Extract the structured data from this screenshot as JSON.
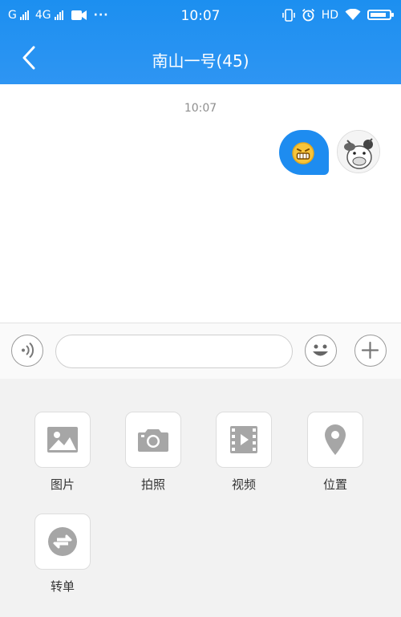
{
  "statusbar": {
    "network": "G",
    "network2": "4G",
    "time": "10:07",
    "hd": "HD",
    "battery_level": 0.85
  },
  "header": {
    "title": "南山一号(45)"
  },
  "chat": {
    "timestamp": "10:07",
    "message_type": "emoji-grin"
  },
  "inputbar": {
    "placeholder": ""
  },
  "panel": {
    "items": [
      {
        "label": "图片",
        "icon": "image-icon"
      },
      {
        "label": "拍照",
        "icon": "camera-icon"
      },
      {
        "label": "视频",
        "icon": "video-icon"
      },
      {
        "label": "位置",
        "icon": "location-icon"
      },
      {
        "label": "转单",
        "icon": "transfer-icon"
      }
    ]
  },
  "colors": {
    "accent": "#1c8ff0",
    "panel_bg": "#f2f2f2",
    "icon_gray": "#9a9a9a"
  }
}
